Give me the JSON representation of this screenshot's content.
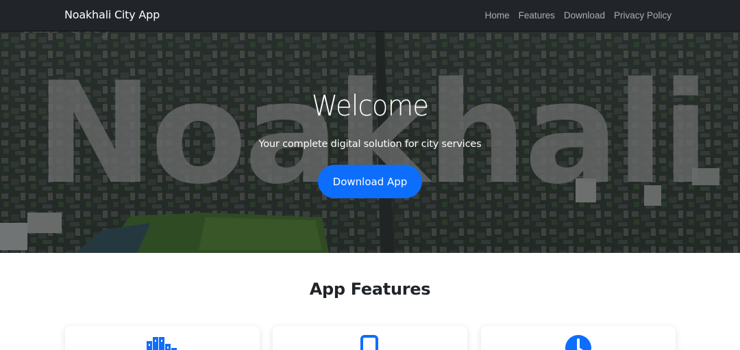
{
  "navbar": {
    "brand": "Noakhali City App",
    "links": [
      "Home",
      "Features",
      "Download",
      "Privacy Policy"
    ]
  },
  "hero": {
    "title": "Welcome",
    "subtitle": "Your complete digital solution for city services",
    "button_label": "Download App",
    "background_text": "Noakhali"
  },
  "features": {
    "title": "App Features",
    "cards": [
      {
        "icon": "buildings-icon"
      },
      {
        "icon": "phone-icon"
      },
      {
        "icon": "clock-icon"
      }
    ]
  },
  "colors": {
    "navbar_bg": "#212529",
    "accent": "#0d6efd",
    "hero_text": "#ffffff"
  }
}
